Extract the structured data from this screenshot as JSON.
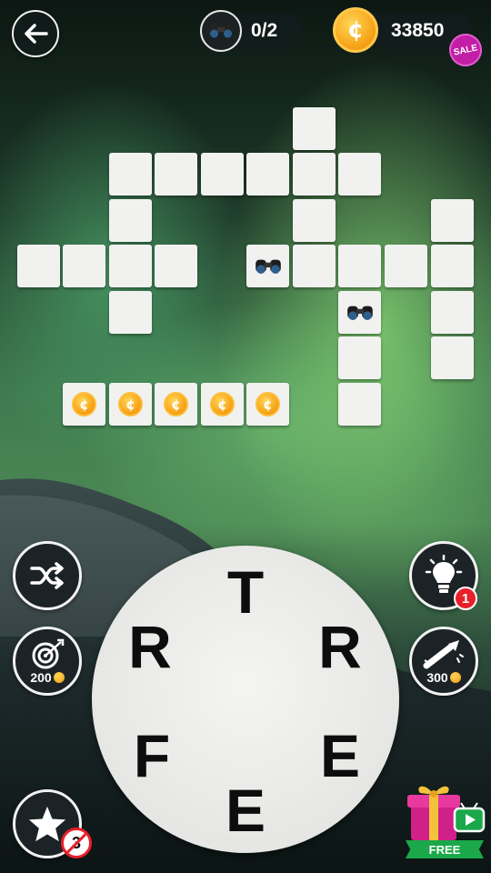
{
  "header": {
    "back_icon": "arrow-left-icon",
    "hints_icon": "binoculars-icon",
    "hints_found": "0/2",
    "coin_icon": "coin-icon",
    "coins": "33850",
    "sale_badge": "SALE"
  },
  "board": {
    "bonus_binocular_cells": 2,
    "coin_cells": 5
  },
  "left_buttons": {
    "shuffle_icon": "shuffle-icon",
    "target_icon": "target-icon",
    "target_cost": "200",
    "star_icon": "star-icon",
    "star_badge": "3"
  },
  "right_buttons": {
    "hint_icon": "lightbulb-icon",
    "hint_badge": "1",
    "rocket_icon": "firework-icon",
    "rocket_cost": "300",
    "gift_icon": "gift-icon",
    "gift_label": "FREE"
  },
  "wheel": {
    "letters": [
      "T",
      "R",
      "R",
      "F",
      "E",
      "E"
    ]
  },
  "colors": {
    "tile": "#f1f2f0",
    "coin": "#f7a61a",
    "sale": "#c21fa6",
    "badge_red": "#e8202a",
    "free_green": "#1aa84a"
  }
}
